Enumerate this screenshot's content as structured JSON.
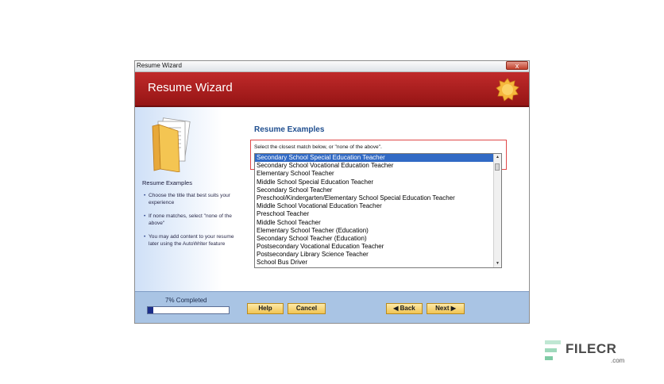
{
  "window": {
    "title": "Resume Wizard",
    "close_label": "x"
  },
  "banner": {
    "title": "Resume Wizard"
  },
  "left_panel": {
    "title": "Resume Examples",
    "bullets": [
      "Choose the title that best suits your experience",
      "If none matches, select \"none of the above\"",
      "You may add content to your resume later using the AutoWriter feature"
    ]
  },
  "main": {
    "title": "Resume Examples",
    "instruction": "Select the closest match below, or \"none of the above\".",
    "list_items": [
      "Secondary School Special Education Teacher",
      "Secondary School Vocational Education Teacher",
      "Elementary School Teacher",
      "Middle School Special Education Teacher",
      "Secondary School Teacher",
      "Preschool/Kindergarten/Elementary School Special Education Teacher",
      "Middle School Vocational Education Teacher",
      "Preschool Teacher",
      "Middle School Teacher",
      "Elementary School Teacher (Education)",
      "Secondary School Teacher (Education)",
      "Postsecondary Vocational Education Teacher",
      "Postsecondary Library Science Teacher",
      "School Bus Driver"
    ],
    "selected_index": 0
  },
  "footer": {
    "progress_label": "7% Completed",
    "progress_fraction": 0.07,
    "help_label": "Help",
    "cancel_label": "Cancel",
    "back_label": "◀ Back",
    "next_label": "Next ▶"
  },
  "watermark": {
    "brand": "FILECR",
    "domain": ".com"
  },
  "colors": {
    "banner": "#b21f1f",
    "accent_title": "#1f4e8f",
    "selection": "#316ac5",
    "button": "#f4cf63"
  }
}
